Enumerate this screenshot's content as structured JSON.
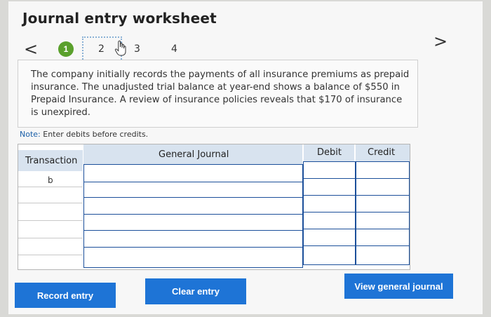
{
  "title": "Journal entry worksheet",
  "nav": {
    "prev_icon": "chevron-left-icon",
    "next_icon": "chevron-right-icon",
    "prev_glyph": "<",
    "next_glyph": ">",
    "steps": [
      "1",
      "2",
      "3",
      "4"
    ],
    "active_step": "1",
    "current_step": "2"
  },
  "prompt": "The company initially records the payments of all insurance premiums as prepaid insurance. The unadjusted trial balance at year-end shows a balance of $550 in Prepaid Insurance. A review of insurance policies reveals that $170 of insurance is unexpired.",
  "note": {
    "label": "Note:",
    "text": "Enter debits before credits."
  },
  "table": {
    "columns": [
      "Transaction",
      "General Journal",
      "Debit",
      "Credit"
    ],
    "transaction": "b",
    "rows": [
      {
        "account": "",
        "debit": "",
        "credit": ""
      },
      {
        "account": "",
        "debit": "",
        "credit": ""
      },
      {
        "account": "",
        "debit": "",
        "credit": ""
      },
      {
        "account": "",
        "debit": "",
        "credit": ""
      },
      {
        "account": "",
        "debit": "",
        "credit": ""
      },
      {
        "account": "",
        "debit": "",
        "credit": ""
      }
    ]
  },
  "buttons": {
    "record": "Record entry",
    "clear": "Clear entry",
    "view": "View general journal"
  },
  "colors": {
    "accent": "#1e74d6",
    "step_active": "#5aa02c",
    "header_bg": "#d8e3ef",
    "cell_border": "#1b4f9a"
  }
}
